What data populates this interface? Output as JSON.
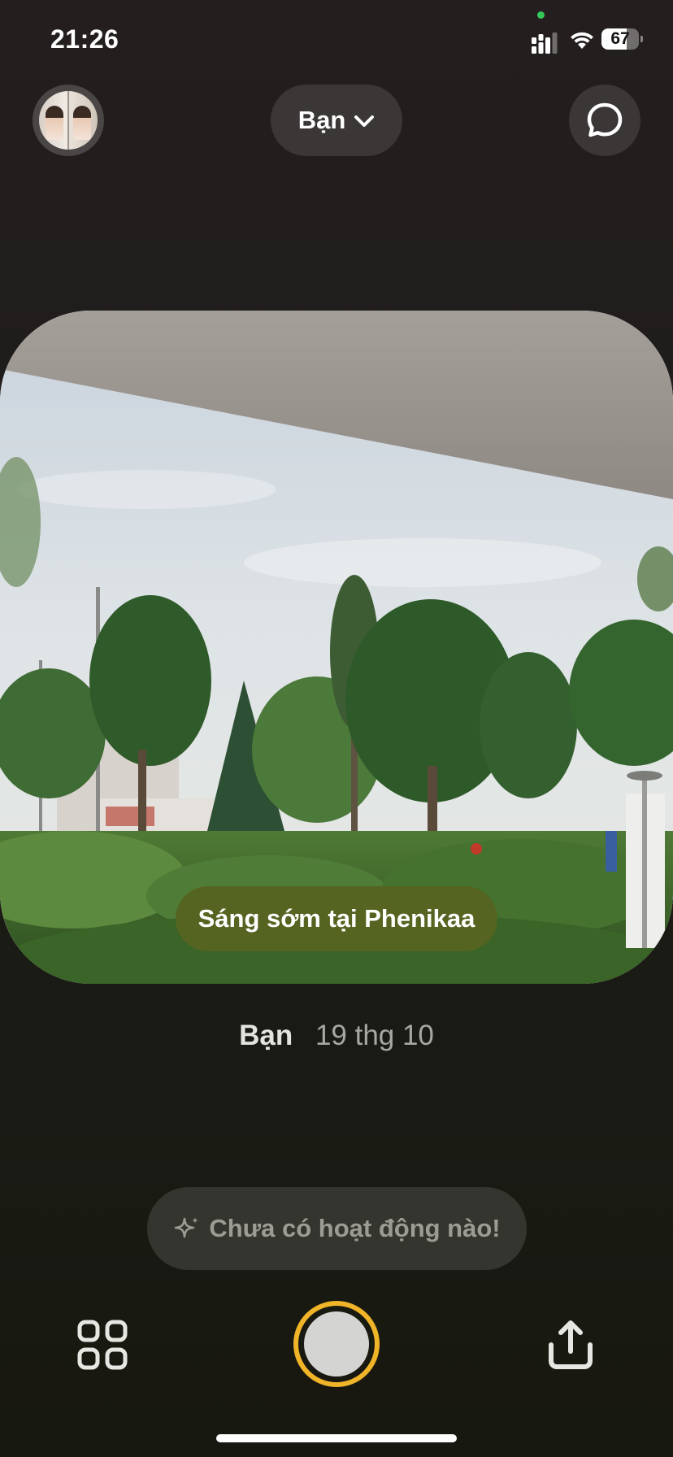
{
  "status_bar": {
    "time": "21:26",
    "battery_level": "67",
    "battery_fraction": 0.67
  },
  "header": {
    "friends_filter_label": "Bạn",
    "avatar_icon": "profile-avatar",
    "chat_icon": "chat-bubble-icon"
  },
  "post": {
    "caption": "Sáng sớm tại Phenikaa",
    "author": "Bạn",
    "date": "19 thg 10"
  },
  "activity": {
    "text": "Chưa có hoạt động nào!",
    "icon": "sparkle-icon"
  },
  "bottom_bar": {
    "grid_icon": "grid-icon",
    "shutter_icon": "shutter-button",
    "share_icon": "share-icon"
  },
  "colors": {
    "shutter_ring": "#f0b429",
    "caption_background": "#556421",
    "privacy_indicator": "#34c759"
  }
}
